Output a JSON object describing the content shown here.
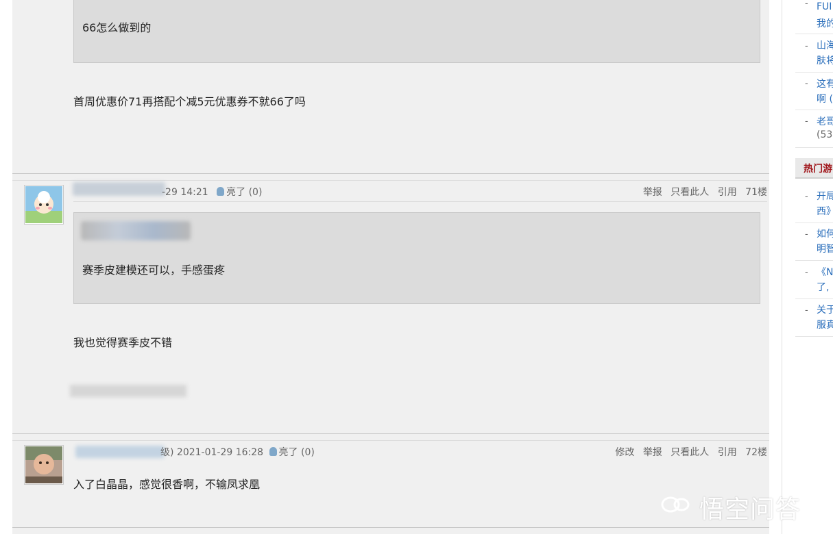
{
  "thread": {
    "post70": {
      "quote_text": "66怎么做到的",
      "reply_text": "首周优惠价71再搭配个减5元优惠券不就66了吗"
    },
    "post71": {
      "date_partial": "-29 14:21",
      "light_label": "亮了",
      "light_count": "(0)",
      "actions": [
        "举报",
        "只看此人",
        "引用"
      ],
      "floor": "71楼",
      "quote_text": "赛季皮建模还可以，手感蛋疼",
      "reply_text": "我也觉得赛季皮不错"
    },
    "post72": {
      "level_partial": "级)",
      "date": "2021-01-29 16:28",
      "light_label": "亮了",
      "light_count": "(0)",
      "actions": [
        "修改",
        "举报",
        "只看此人",
        "引用"
      ],
      "floor": "72楼",
      "reply_text": "入了白晶晶，感觉很香啊，不输凤求凰"
    }
  },
  "sidebar": {
    "items_top": [
      {
        "line1": "FUI",
        "line2": "我的"
      },
      {
        "line1": "山海",
        "line2": "肤将"
      },
      {
        "line1": "这有",
        "line2": "啊 ("
      },
      {
        "line1": "老哥",
        "line2": "(53"
      }
    ],
    "section_title": "热门游",
    "items_bottom": [
      {
        "line1": "开局",
        "line2": "西》"
      },
      {
        "line1": "如何",
        "line2": "明智"
      },
      {
        "line1": "《N",
        "line2": "了,"
      },
      {
        "line1": "关于",
        "line2": "服真"
      }
    ]
  },
  "watermark": "悟空问答",
  "colors": {
    "link": "#2a6ebb",
    "section_title": "#a0161b",
    "panel_bg": "#f0f0f0",
    "quote_bg": "#dcdcdc"
  }
}
